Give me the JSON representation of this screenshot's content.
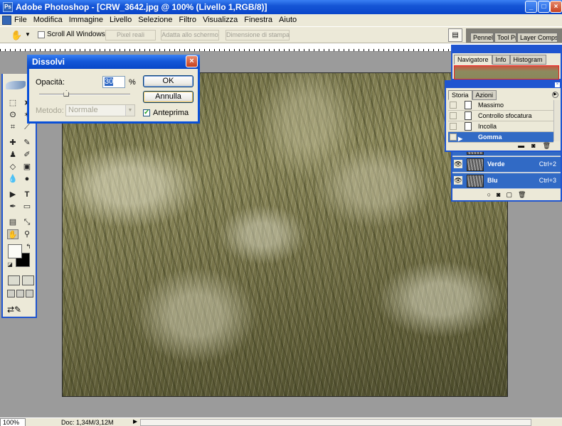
{
  "window": {
    "title": "Adobe Photoshop - [CRW_3642.jpg @ 100% (Livello 1,RGB/8)]"
  },
  "menubar": {
    "items": [
      {
        "label": "File"
      },
      {
        "label": "Modifica"
      },
      {
        "label": "Immagine"
      },
      {
        "label": "Livello"
      },
      {
        "label": "Selezione"
      },
      {
        "label": "Filtro"
      },
      {
        "label": "Visualizza"
      },
      {
        "label": "Finestra"
      },
      {
        "label": "Aiuto"
      }
    ]
  },
  "optionsbar": {
    "scroll_all_label": "Scroll All Windows",
    "buttons": [
      {
        "label": "Pixel reali"
      },
      {
        "label": "Adatta allo schermo"
      },
      {
        "label": "Dimensione di stampa"
      }
    ],
    "well_tabs": [
      {
        "label": "Pennell"
      },
      {
        "label": "Tool Pr"
      },
      {
        "label": "Layer Comps"
      }
    ]
  },
  "dialog": {
    "title": "Dissolvi",
    "opacity_label": "Opacità:",
    "opacity_value": "30",
    "opacity_unit": "%",
    "opacity_slider_percent": 30,
    "method_label": "Metodo:",
    "method_value": "Normale",
    "ok_label": "OK",
    "cancel_label": "Annulla",
    "preview_label": "Anteprima",
    "preview_checked": true
  },
  "navigator": {
    "tabs": [
      {
        "label": "Navigatore"
      },
      {
        "label": "Info"
      },
      {
        "label": "Histogram"
      }
    ]
  },
  "history": {
    "tabs": [
      {
        "label": "Storia"
      },
      {
        "label": "Azioni"
      }
    ],
    "items": [
      {
        "label": "Massimo"
      },
      {
        "label": "Controllo sfocatura"
      },
      {
        "label": "Incolla"
      },
      {
        "label": "Gomma"
      }
    ],
    "selected_index": 3
  },
  "channels": {
    "rows": [
      {
        "name": "Verde",
        "shortcut": "Ctrl+2"
      },
      {
        "name": "Blu",
        "shortcut": "Ctrl+3"
      }
    ]
  },
  "status": {
    "zoom": "100%",
    "doc": "Doc: 1,34M/3,12M"
  },
  "colors": {
    "xp_blue": "#1f55d0",
    "selection": "#316ac5",
    "chrome": "#ece9d8"
  }
}
